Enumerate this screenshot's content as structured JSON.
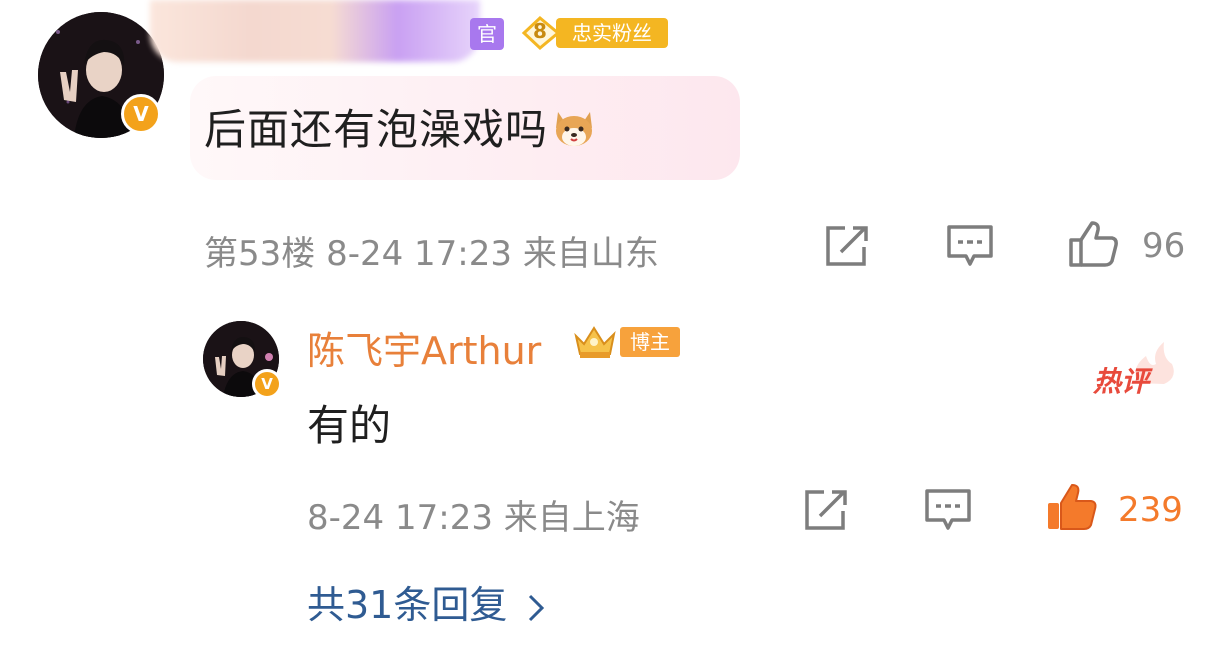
{
  "comment": {
    "official_tag": "官",
    "fan_level": "8",
    "fan_badge": "忠实粉丝",
    "text": "后面还有泡澡戏吗",
    "emoji_icon": "shiba-dog-emoji",
    "meta": "第53楼 8-24 17:23 来自山东",
    "like_count": "96"
  },
  "reply": {
    "author": "陈飞宇Arthur",
    "author_badge": "博主",
    "text": "有的",
    "hot_label": "热评",
    "meta": "8-24 17:23 来自上海",
    "like_count": "239",
    "liked": true
  },
  "more_replies": "共31条回复",
  "colors": {
    "accent_orange": "#f47a2b",
    "link_blue": "#2f5b92",
    "meta_gray": "#8a8a8a",
    "badge_gold": "#f4b622"
  }
}
